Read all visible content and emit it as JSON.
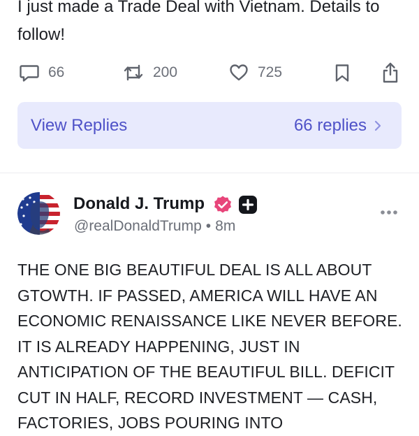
{
  "previous_post": {
    "text": "I just made a Trade Deal with Vietnam. Details to follow!",
    "reply_count": "66",
    "retruth_count": "200",
    "like_count": "725"
  },
  "view_replies": {
    "label": "View Replies",
    "count_text": "66 replies"
  },
  "post": {
    "author_name": "Donald J. Trump",
    "handle": "@realDonaldTrump",
    "separator": "•",
    "time": "8m",
    "body": "THE ONE BIG BEAUTIFUL DEAL IS ALL ABOUT GTOWTH. IF PASSED, AMERICA WILL HAVE AN ECONOMIC RENAISSANCE LIKE NEVER BEFORE. IT IS ALREADY HAPPENING, JUST IN ANTICIPATION OF THE BEAUTIFUL BILL. DEFICIT CUT IN HALF, RECORD INVESTMENT — CASH, FACTORIES, JOBS POURING INTO"
  },
  "colors": {
    "accent": "#4f52c8",
    "view_replies_bg": "#e8eafd",
    "verified_badge": "#e8457a",
    "muted_text": "#6b6f78"
  },
  "icons": {
    "reply": "speech-bubble-icon",
    "retruth": "retruth-icon",
    "like": "heart-icon",
    "bookmark": "bookmark-icon",
    "share": "share-icon",
    "verified": "verified-badge-icon",
    "plus": "plus-badge-icon",
    "more": "more-options-icon",
    "chevron": "chevron-right-icon"
  }
}
